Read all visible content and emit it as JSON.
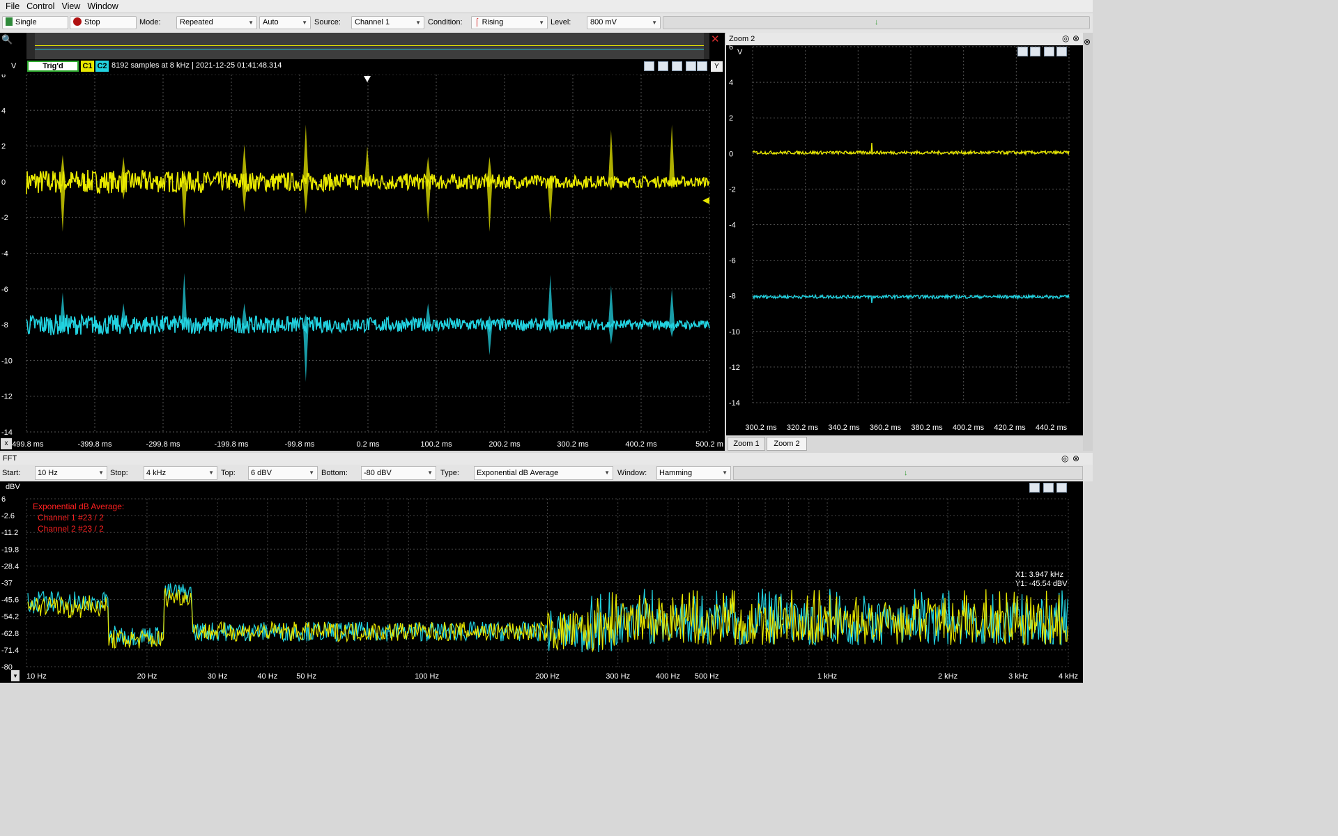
{
  "menu": [
    "File",
    "Control",
    "View",
    "Window"
  ],
  "toolbar": {
    "single": "Single",
    "stop": "Stop",
    "mode_label": "Mode:",
    "mode_value": "Repeated",
    "auto_value": "Auto",
    "source_label": "Source:",
    "source_value": "Channel 1",
    "condition_label": "Condition:",
    "condition_value": "Rising",
    "level_label": "Level:",
    "level_value": "800 mV"
  },
  "scope": {
    "status": "Trig'd",
    "c1": "C1",
    "c2": "C2",
    "info": "8192 samples at 8 kHz | 2021-12-25 01:41:48.314",
    "y_unit": "V",
    "y_ticks": [
      "6",
      "4",
      "2",
      "0",
      "-2",
      "-4",
      "-6",
      "-8",
      "-10",
      "-12",
      "-14"
    ],
    "x_ticks": [
      "-499.8 ms",
      "-399.8 ms",
      "-299.8 ms",
      "-199.8 ms",
      "-99.8 ms",
      "0.2 ms",
      "100.2 ms",
      "200.2 ms",
      "300.2 ms",
      "400.2 ms",
      "500.2 m"
    ],
    "y_button": "Y",
    "x_button": "x",
    "colors": {
      "c1": "#e8e800",
      "c2": "#22d2e0"
    }
  },
  "zoom": {
    "title": "Zoom 2",
    "y_unit": "V",
    "y_ticks": [
      "6",
      "4",
      "2",
      "0",
      "-2",
      "-4",
      "-6",
      "-8",
      "-10",
      "-12",
      "-14"
    ],
    "x_ticks": [
      "300.2 ms",
      "320.2 ms",
      "340.2 ms",
      "360.2 ms",
      "380.2 ms",
      "400.2 ms",
      "420.2 ms",
      "440.2 ms"
    ],
    "tabs": [
      "Zoom 1",
      "Zoom 2"
    ]
  },
  "fft": {
    "title": "FFT",
    "start_label": "Start:",
    "start_value": "10 Hz",
    "stop_label": "Stop:",
    "stop_value": "4 kHz",
    "top_label": "Top:",
    "top_value": "6 dBV",
    "bottom_label": "Bottom:",
    "bottom_value": "-80 dBV",
    "type_label": "Type:",
    "type_value": "Exponential dB Average",
    "window_label": "Window:",
    "window_value": "Hamming",
    "y_unit": "dBV",
    "y_ticks": [
      "6",
      "-2.6",
      "-11.2",
      "-19.8",
      "-28.4",
      "-37",
      "-45.6",
      "-54.2",
      "-62.8",
      "-71.4",
      "-80"
    ],
    "x_ticks": [
      "10 Hz",
      "20 Hz",
      "30 Hz",
      "40 Hz",
      "50 Hz",
      "100 Hz",
      "200 Hz",
      "300 Hz",
      "400 Hz",
      "500 Hz",
      "1 kHz",
      "2 kHz",
      "3 kHz",
      "4 kHz"
    ],
    "legend": [
      "Exponential dB Average:",
      "Channel 1 #23 / 2",
      "Channel 2 #23 / 2"
    ],
    "cursor": [
      "X1: 3.947 kHz",
      "Y1: -45.54 dBV"
    ]
  }
}
